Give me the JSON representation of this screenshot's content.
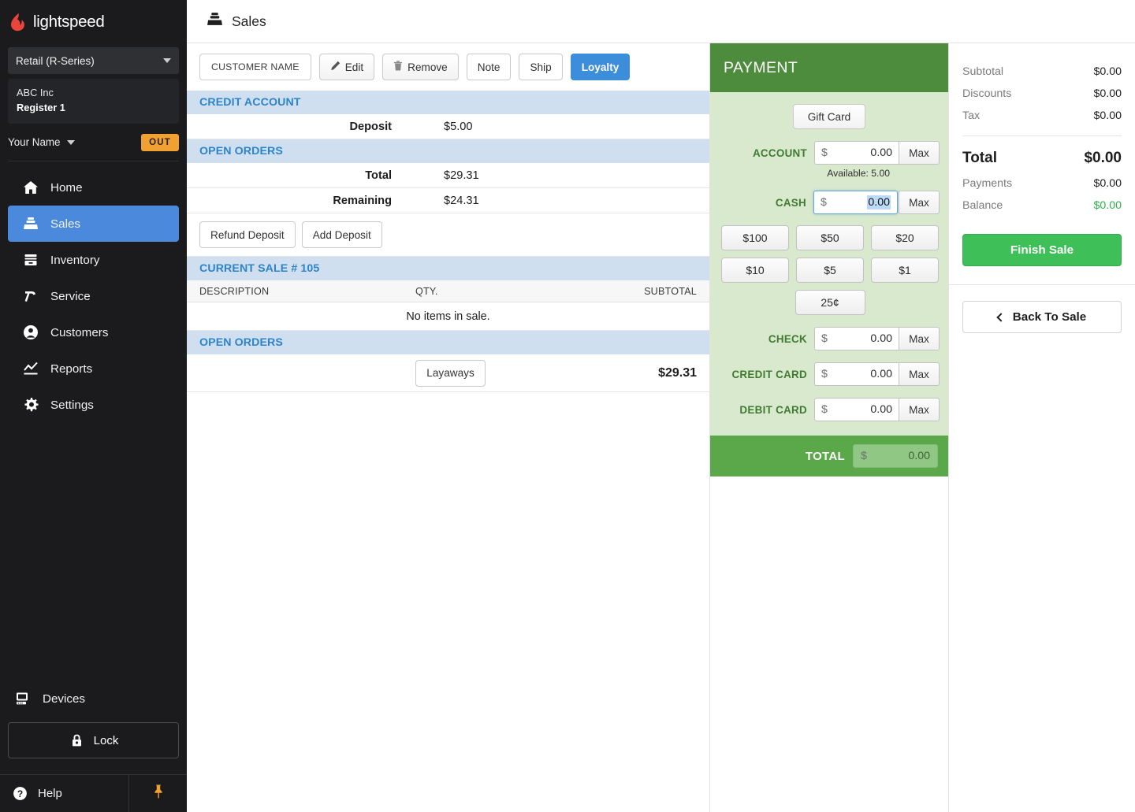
{
  "sidebar": {
    "brand": "lightspeed",
    "store_selector": {
      "label": "Retail (R-Series)"
    },
    "register": {
      "company": "ABC Inc",
      "register": "Register 1"
    },
    "user": {
      "name": "Your Name",
      "status_badge": "OUT"
    },
    "nav": [
      {
        "label": "Home",
        "icon": "home-icon",
        "active": false
      },
      {
        "label": "Sales",
        "icon": "cash-register-icon",
        "active": true
      },
      {
        "label": "Inventory",
        "icon": "inventory-box-icon",
        "active": false
      },
      {
        "label": "Service",
        "icon": "hammer-icon",
        "active": false
      },
      {
        "label": "Customers",
        "icon": "user-circle-icon",
        "active": false
      },
      {
        "label": "Reports",
        "icon": "chart-line-icon",
        "active": false
      },
      {
        "label": "Settings",
        "icon": "gear-icon",
        "active": false
      }
    ],
    "devices": {
      "label": "Devices",
      "icon": "monitor-icon"
    },
    "lock": {
      "label": "Lock",
      "icon": "lock-icon"
    },
    "help": {
      "label": "Help",
      "icon": "question-circle-icon"
    },
    "pin": {
      "icon": "pushpin-icon"
    }
  },
  "topbar": {
    "title": "Sales",
    "icon": "cash-register-icon"
  },
  "customer_toolbar": {
    "customer_name": "CUSTOMER NAME",
    "edit": "Edit",
    "remove": "Remove",
    "note": "Note",
    "ship": "Ship",
    "loyalty": "Loyalty"
  },
  "credit_account": {
    "heading": "CREDIT ACCOUNT",
    "rows": [
      {
        "label": "Deposit",
        "value": "$5.00"
      }
    ]
  },
  "open_orders_top": {
    "heading": "OPEN ORDERS",
    "rows": [
      {
        "label": "Total",
        "value": "$29.31"
      },
      {
        "label": "Remaining",
        "value": "$24.31"
      }
    ],
    "refund_deposit": "Refund Deposit",
    "add_deposit": "Add Deposit"
  },
  "current_sale": {
    "heading": "CURRENT SALE # 105",
    "columns": [
      "DESCRIPTION",
      "QTY.",
      "SUBTOTAL"
    ],
    "empty_message": "No items in sale."
  },
  "open_orders_bottom": {
    "heading": "OPEN ORDERS",
    "layaways_label": "Layaways",
    "amount": "$29.31"
  },
  "payment": {
    "title": "PAYMENT",
    "gift_card": "Gift Card",
    "max_label": "Max",
    "currency_symbol": "$",
    "fields": [
      {
        "label": "ACCOUNT",
        "value": "0.00",
        "note": "Available: 5.00",
        "focused": false
      },
      {
        "label": "CASH",
        "value": "0.00",
        "note": "",
        "focused": true
      },
      {
        "label": "CHECK",
        "value": "0.00",
        "note": "",
        "focused": false
      },
      {
        "label": "CREDIT CARD",
        "value": "0.00",
        "note": "",
        "focused": false
      },
      {
        "label": "DEBIT CARD",
        "value": "0.00",
        "note": "",
        "focused": false
      }
    ],
    "denominations": [
      "$100",
      "$50",
      "$20",
      "$10",
      "$5",
      "$1",
      "25¢"
    ],
    "total_label": "TOTAL",
    "total_value": "0.00"
  },
  "totals": {
    "rows": [
      {
        "label": "Subtotal",
        "value": "$0.00"
      },
      {
        "label": "Discounts",
        "value": "$0.00"
      },
      {
        "label": "Tax",
        "value": "$0.00"
      }
    ],
    "total": {
      "label": "Total",
      "value": "$0.00"
    },
    "after": [
      {
        "label": "Payments",
        "value": "$0.00",
        "green": false
      },
      {
        "label": "Balance",
        "value": "$0.00",
        "green": true
      }
    ],
    "finish_sale": "Finish Sale",
    "back_to_sale": "Back To Sale"
  },
  "colors": {
    "sidebar_bg": "#1b1b1d",
    "accent_blue": "#4a89dc",
    "payment_green": "#4d8c3d",
    "payment_light": "#d9e9cd",
    "finish_green": "#3ebf57",
    "section_blue": "#cfdfef",
    "badge_orange": "#f0a132",
    "balance_green": "#2fb24c"
  }
}
